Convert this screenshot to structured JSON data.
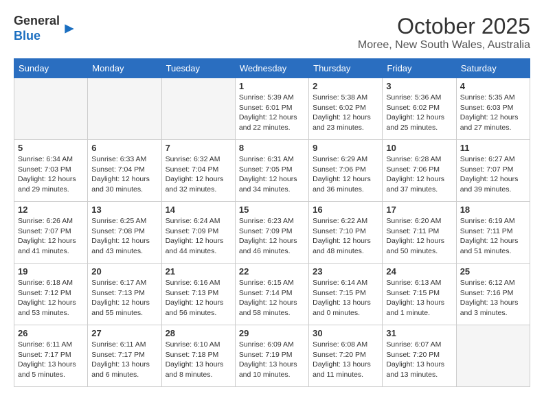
{
  "header": {
    "logo_line1": "General",
    "logo_line2": "Blue",
    "title": "October 2025",
    "subtitle": "Moree, New South Wales, Australia"
  },
  "days_of_week": [
    "Sunday",
    "Monday",
    "Tuesday",
    "Wednesday",
    "Thursday",
    "Friday",
    "Saturday"
  ],
  "weeks": [
    [
      {
        "num": "",
        "info": ""
      },
      {
        "num": "",
        "info": ""
      },
      {
        "num": "",
        "info": ""
      },
      {
        "num": "1",
        "info": "Sunrise: 5:39 AM\nSunset: 6:01 PM\nDaylight: 12 hours\nand 22 minutes."
      },
      {
        "num": "2",
        "info": "Sunrise: 5:38 AM\nSunset: 6:02 PM\nDaylight: 12 hours\nand 23 minutes."
      },
      {
        "num": "3",
        "info": "Sunrise: 5:36 AM\nSunset: 6:02 PM\nDaylight: 12 hours\nand 25 minutes."
      },
      {
        "num": "4",
        "info": "Sunrise: 5:35 AM\nSunset: 6:03 PM\nDaylight: 12 hours\nand 27 minutes."
      }
    ],
    [
      {
        "num": "5",
        "info": "Sunrise: 6:34 AM\nSunset: 7:03 PM\nDaylight: 12 hours\nand 29 minutes."
      },
      {
        "num": "6",
        "info": "Sunrise: 6:33 AM\nSunset: 7:04 PM\nDaylight: 12 hours\nand 30 minutes."
      },
      {
        "num": "7",
        "info": "Sunrise: 6:32 AM\nSunset: 7:04 PM\nDaylight: 12 hours\nand 32 minutes."
      },
      {
        "num": "8",
        "info": "Sunrise: 6:31 AM\nSunset: 7:05 PM\nDaylight: 12 hours\nand 34 minutes."
      },
      {
        "num": "9",
        "info": "Sunrise: 6:29 AM\nSunset: 7:06 PM\nDaylight: 12 hours\nand 36 minutes."
      },
      {
        "num": "10",
        "info": "Sunrise: 6:28 AM\nSunset: 7:06 PM\nDaylight: 12 hours\nand 37 minutes."
      },
      {
        "num": "11",
        "info": "Sunrise: 6:27 AM\nSunset: 7:07 PM\nDaylight: 12 hours\nand 39 minutes."
      }
    ],
    [
      {
        "num": "12",
        "info": "Sunrise: 6:26 AM\nSunset: 7:07 PM\nDaylight: 12 hours\nand 41 minutes."
      },
      {
        "num": "13",
        "info": "Sunrise: 6:25 AM\nSunset: 7:08 PM\nDaylight: 12 hours\nand 43 minutes."
      },
      {
        "num": "14",
        "info": "Sunrise: 6:24 AM\nSunset: 7:09 PM\nDaylight: 12 hours\nand 44 minutes."
      },
      {
        "num": "15",
        "info": "Sunrise: 6:23 AM\nSunset: 7:09 PM\nDaylight: 12 hours\nand 46 minutes."
      },
      {
        "num": "16",
        "info": "Sunrise: 6:22 AM\nSunset: 7:10 PM\nDaylight: 12 hours\nand 48 minutes."
      },
      {
        "num": "17",
        "info": "Sunrise: 6:20 AM\nSunset: 7:11 PM\nDaylight: 12 hours\nand 50 minutes."
      },
      {
        "num": "18",
        "info": "Sunrise: 6:19 AM\nSunset: 7:11 PM\nDaylight: 12 hours\nand 51 minutes."
      }
    ],
    [
      {
        "num": "19",
        "info": "Sunrise: 6:18 AM\nSunset: 7:12 PM\nDaylight: 12 hours\nand 53 minutes."
      },
      {
        "num": "20",
        "info": "Sunrise: 6:17 AM\nSunset: 7:13 PM\nDaylight: 12 hours\nand 55 minutes."
      },
      {
        "num": "21",
        "info": "Sunrise: 6:16 AM\nSunset: 7:13 PM\nDaylight: 12 hours\nand 56 minutes."
      },
      {
        "num": "22",
        "info": "Sunrise: 6:15 AM\nSunset: 7:14 PM\nDaylight: 12 hours\nand 58 minutes."
      },
      {
        "num": "23",
        "info": "Sunrise: 6:14 AM\nSunset: 7:15 PM\nDaylight: 13 hours\nand 0 minutes."
      },
      {
        "num": "24",
        "info": "Sunrise: 6:13 AM\nSunset: 7:15 PM\nDaylight: 13 hours\nand 1 minute."
      },
      {
        "num": "25",
        "info": "Sunrise: 6:12 AM\nSunset: 7:16 PM\nDaylight: 13 hours\nand 3 minutes."
      }
    ],
    [
      {
        "num": "26",
        "info": "Sunrise: 6:11 AM\nSunset: 7:17 PM\nDaylight: 13 hours\nand 5 minutes."
      },
      {
        "num": "27",
        "info": "Sunrise: 6:11 AM\nSunset: 7:17 PM\nDaylight: 13 hours\nand 6 minutes."
      },
      {
        "num": "28",
        "info": "Sunrise: 6:10 AM\nSunset: 7:18 PM\nDaylight: 13 hours\nand 8 minutes."
      },
      {
        "num": "29",
        "info": "Sunrise: 6:09 AM\nSunset: 7:19 PM\nDaylight: 13 hours\nand 10 minutes."
      },
      {
        "num": "30",
        "info": "Sunrise: 6:08 AM\nSunset: 7:20 PM\nDaylight: 13 hours\nand 11 minutes."
      },
      {
        "num": "31",
        "info": "Sunrise: 6:07 AM\nSunset: 7:20 PM\nDaylight: 13 hours\nand 13 minutes."
      },
      {
        "num": "",
        "info": ""
      }
    ]
  ]
}
